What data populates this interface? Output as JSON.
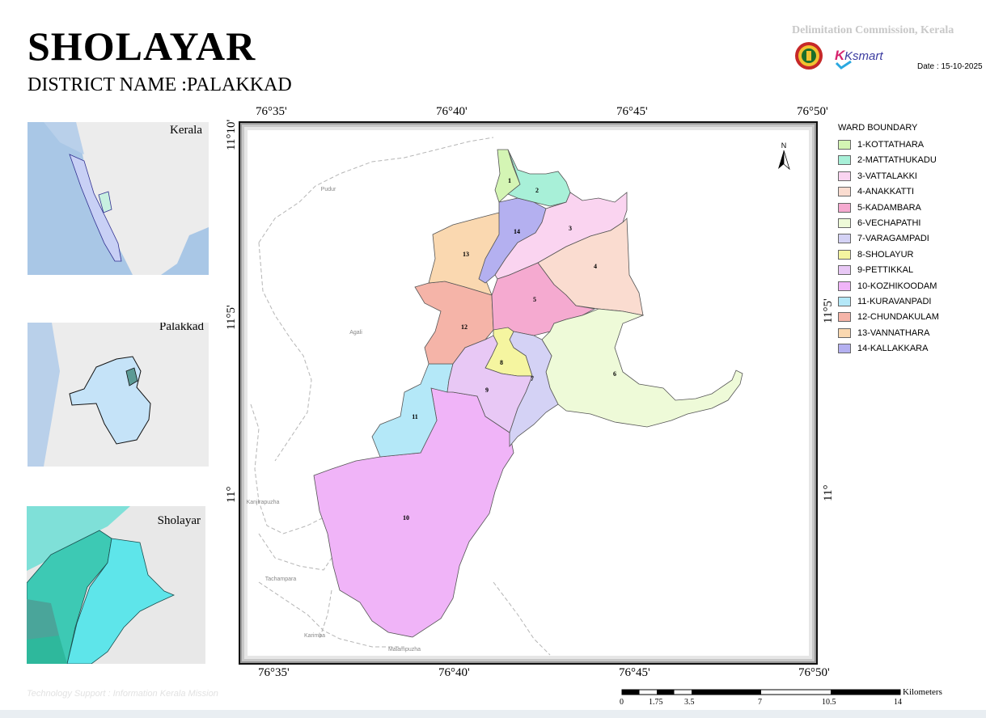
{
  "header": {
    "title": "SHOLAYAR",
    "district": "DISTRICT NAME :PALAKKAD",
    "commission": "Delimitation Commission, Kerala",
    "date": "Date : 15-10-2025",
    "ksmart": "Ksmart"
  },
  "insets": {
    "kerala": "Kerala",
    "palakkad": "Palakkad",
    "sholayar": "Sholayar"
  },
  "coords": {
    "top": [
      "76°35'",
      "76°40'",
      "76°45'",
      "76°50'"
    ],
    "bottom": [
      "76°35'",
      "76°40'",
      "76°45'",
      "76°50'"
    ],
    "left": [
      "11°10'",
      "11°5'",
      "11°"
    ],
    "right": [
      "11°5'",
      "11°"
    ]
  },
  "map": {
    "north": "N",
    "places": [
      "Pudur",
      "Agali",
      "Kanjirapuzha",
      "Tachampara",
      "Karimba",
      "Malampuzha"
    ]
  },
  "legend": {
    "title": "WARD BOUNDARY",
    "items": [
      {
        "label": "1-KOTTATHARA",
        "color": "#d4f5b4"
      },
      {
        "label": "2-MATTATHUKADU",
        "color": "#a8f0d8"
      },
      {
        "label": "3-VATTALAKKI",
        "color": "#fad4f0"
      },
      {
        "label": "4-ANAKKATTI",
        "color": "#fadcd0"
      },
      {
        "label": "5-KADAMBARA",
        "color": "#f5aad0"
      },
      {
        "label": "6-VECHAPATHI",
        "color": "#eefad8"
      },
      {
        "label": "7-VARAGAMPADI",
        "color": "#d4d2f5"
      },
      {
        "label": "8-SHOLAYUR",
        "color": "#f5f5a0"
      },
      {
        "label": "9-PETTIKKAL",
        "color": "#e8c8f5"
      },
      {
        "label": "10-KOZHIKOODAM",
        "color": "#f0b4f8"
      },
      {
        "label": "11-KURAVANPADI",
        "color": "#b4e8f8"
      },
      {
        "label": "12-CHUNDAKULAM",
        "color": "#f5b4a8"
      },
      {
        "label": "13-VANNATHARA",
        "color": "#fad8b0"
      },
      {
        "label": "14-KALLAKKARA",
        "color": "#b4b0f0"
      }
    ]
  },
  "wards": [
    "1",
    "2",
    "3",
    "4",
    "5",
    "6",
    "7",
    "8",
    "9",
    "10",
    "11",
    "12",
    "13",
    "14"
  ],
  "scale": {
    "labels": [
      "0",
      "1.75",
      "3.5",
      "7",
      "10.5",
      "14"
    ],
    "unit": "Kilometers"
  },
  "footer": {
    "tech": "Technology Support : Information Kerala Mission"
  }
}
